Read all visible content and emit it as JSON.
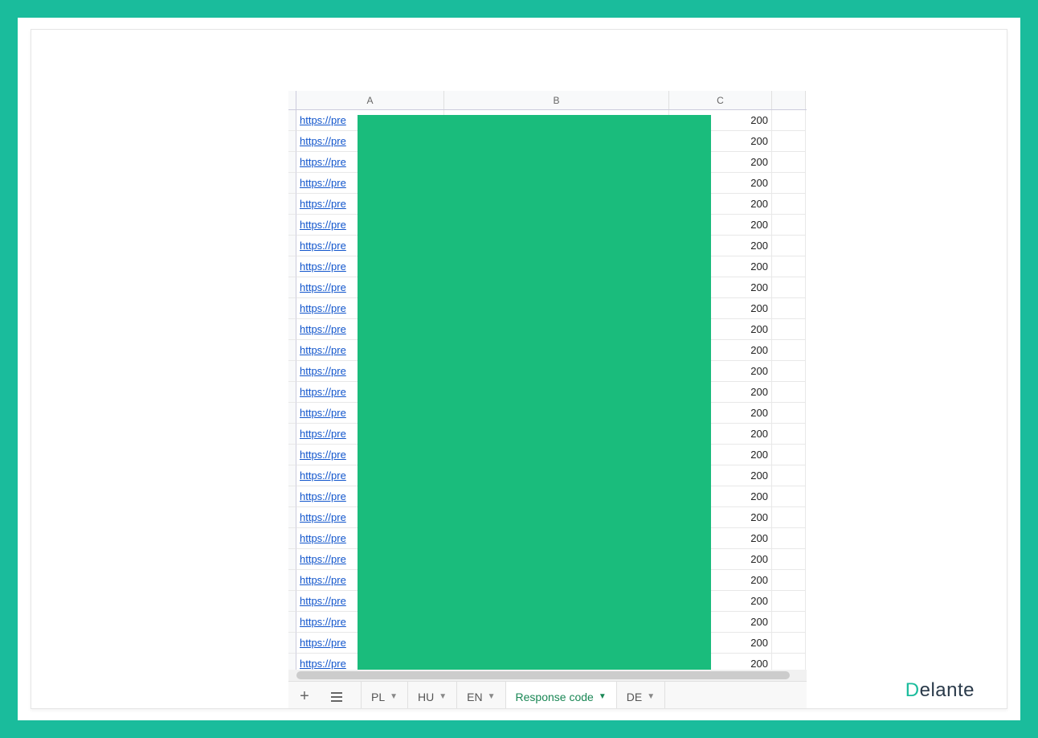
{
  "columns": {
    "a": "A",
    "b": "B",
    "c": "C"
  },
  "url_prefix": "https://pre",
  "response_value": "200",
  "row_count": 27,
  "tabs": [
    {
      "label": "PL",
      "active": false
    },
    {
      "label": "HU",
      "active": false
    },
    {
      "label": "EN",
      "active": false
    },
    {
      "label": "Response code",
      "active": true
    },
    {
      "label": "DE",
      "active": false
    }
  ],
  "brand": {
    "first": "D",
    "rest": "elante"
  }
}
